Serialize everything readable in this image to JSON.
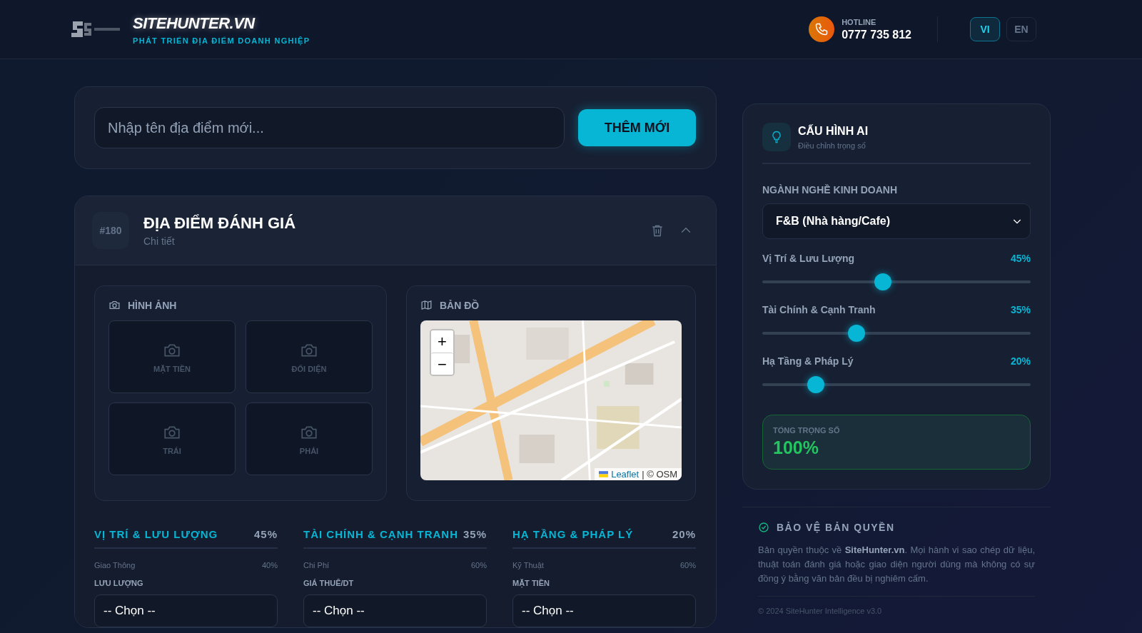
{
  "header": {
    "brand": "SITEHUNTER.VN",
    "tagline": "PHÁT TRIỂN ĐỊA ĐIỂM DOANH NGHIỆP",
    "hotline_label": "HOTLINE",
    "hotline_number": "0777 735 812",
    "languages": [
      {
        "label": "VI",
        "selected": true
      },
      {
        "label": "EN",
        "selected": false
      }
    ]
  },
  "add_form": {
    "placeholder": "Nhập tên địa điểm mới...",
    "button": "THÊM MỚI"
  },
  "location": {
    "number": "#180",
    "title": "ĐỊA ĐIỂM ĐÁNH GIÁ",
    "subtitle": "Chi tiết",
    "images": {
      "title": "HÌNH ẢNH",
      "slots": [
        "MẶT TIỀN",
        "ĐỐI DIỆN",
        "TRÁI",
        "PHẢI"
      ]
    },
    "map": {
      "title": "BẢN ĐỒ",
      "zoom_in": "+",
      "zoom_out": "−",
      "attribution_link": "Leaflet",
      "attribution": "| © OSM"
    },
    "criteria": [
      {
        "title": "VỊ TRÍ & LƯU LƯỢNG",
        "weight": "45%",
        "sub_label": "Giao Thông",
        "sub_weight": "40%",
        "field_label": "LƯU LƯỢNG",
        "select_value": "-- Chọn --"
      },
      {
        "title": "TÀI CHÍNH & CẠNH TRANH",
        "weight": "35%",
        "sub_label": "Chi Phí",
        "sub_weight": "60%",
        "field_label": "GIÁ THUÊ/DT",
        "select_value": "-- Chọn --"
      },
      {
        "title": "HẠ TẦNG & PHÁP LÝ",
        "weight": "20%",
        "sub_label": "Kỹ Thuật",
        "sub_weight": "60%",
        "field_label": "MẶT TIỀN",
        "select_value": "-- Chọn --"
      }
    ]
  },
  "ai_config": {
    "title": "CẤU HÌNH AI",
    "subtitle": "Điều chỉnh trọng số",
    "industry_label": "NGÀNH NGHỀ KINH DOANH",
    "industry_value": "F&B (Nhà hàng/Cafe)",
    "weights": [
      {
        "label": "Vị Trí & Lưu Lượng",
        "value": "45%",
        "level": 0.45
      },
      {
        "label": "Tài Chính & Cạnh Tranh",
        "value": "35%",
        "level": 0.35
      },
      {
        "label": "Hạ Tầng & Pháp Lý",
        "value": "20%",
        "level": 0.2
      }
    ],
    "total_label": "TỔNG TRỌNG SỐ",
    "total_value": "100%"
  },
  "copyright": {
    "title": "BẢO VỆ BẢN QUYỀN",
    "text": "Bản quyền thuộc về **SiteHunter.vn**. Mọi hành vi sao chép dữ liệu, thuật toán đánh giá hoặc giao diện người dùng mà không có sự đồng ý bằng văn bản đều bị nghiêm cấm.",
    "footer": "© 2024 SiteHunter Intelligence v3.0"
  }
}
